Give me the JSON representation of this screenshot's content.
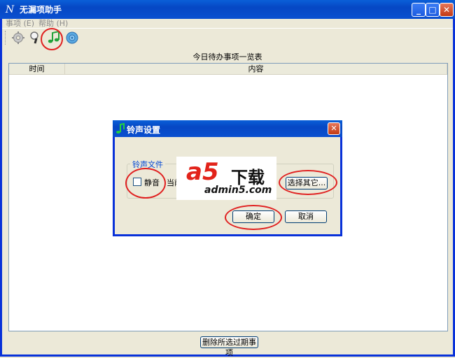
{
  "window": {
    "title": "无漏项助手"
  },
  "menu": [
    {
      "label": "事项 (E)"
    },
    {
      "label": "帮助 (H)"
    }
  ],
  "toolbar": {
    "icons": [
      "settings-gear-icon",
      "search-magnifier-icon",
      "music-note-icon",
      "globe-icon"
    ]
  },
  "list": {
    "heading": "今日待办事项一览表",
    "columns": [
      "时间",
      "内容"
    ]
  },
  "bottom": {
    "delete_expired_label": "删除所选过期事项"
  },
  "dialog": {
    "title": "铃声设置",
    "group_label": "铃声文件",
    "mute_label": "静音",
    "mute_checked": false,
    "current_label": "当前",
    "choose_other_label": "选择其它...",
    "ok_label": "确定",
    "cancel_label": "取消"
  },
  "watermark": {
    "brand": "a5",
    "text": "下载",
    "url": "admin5.com"
  },
  "colors": {
    "titlebar": "#0a5fd8",
    "window_bg": "#ece9d8",
    "annotation": "#e02020",
    "group_label": "#0046d5"
  }
}
